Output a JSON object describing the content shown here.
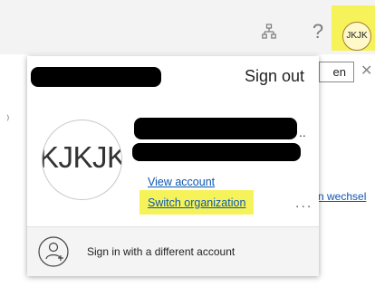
{
  "top_bar": {
    "org_icon": "org-chart-icon",
    "help_icon_glyph": "?",
    "avatar_initials": "JKJK",
    "highlight_color": "#f6f35a"
  },
  "background": {
    "input_text": "en",
    "close_glyph": "✕",
    "link_text": "n wechsel",
    "tick_glyph": "⁾"
  },
  "account_panel": {
    "sign_out_label": "Sign out",
    "avatar_initials": "KJKJKJ",
    "view_account_label": "View account",
    "switch_organization_label": "Switch organization",
    "more_options_glyph": "...",
    "trailing_dots": "..",
    "sign_in_different_label": "Sign in with a different account",
    "add_account_icon": "person-add-icon"
  }
}
